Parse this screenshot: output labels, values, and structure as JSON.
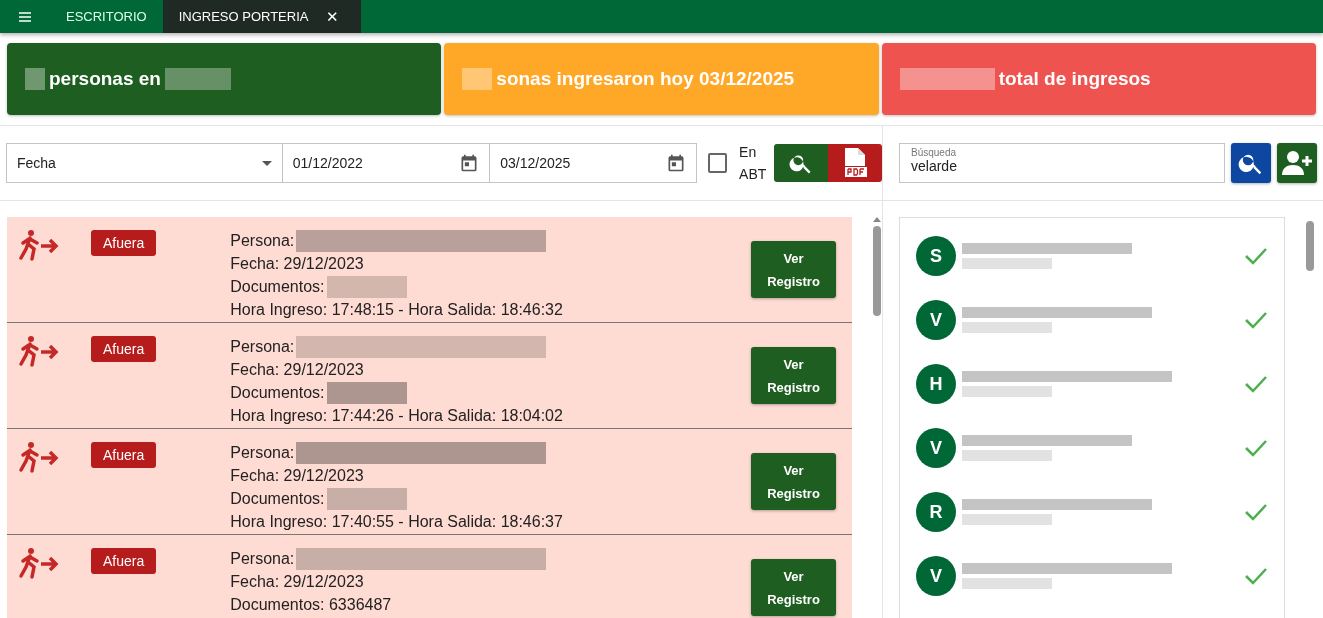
{
  "tabs": [
    {
      "label": "ESCRITORIO",
      "selected": false
    },
    {
      "label": "INGRESO PORTERIA",
      "selected": true,
      "close": "✕"
    }
  ],
  "stats": [
    {
      "text": "personas en",
      "color": "#1e5e20"
    },
    {
      "text": "sonas ingresaron hoy 03/12/2025",
      "color": "#ffa726"
    },
    {
      "text": "total de ingresos",
      "color": "#ef5350"
    }
  ],
  "filters": {
    "type_select": "Fecha",
    "date_from": "01/12/2022",
    "date_to": "03/12/2025",
    "abt": {
      "label_lines": [
        "En",
        "ABT"
      ],
      "checked": false
    },
    "search": {
      "label": "Búsqueda",
      "value": "velarde"
    }
  },
  "records": [
    {
      "status": "Afuera",
      "persona": "Persona:",
      "fecha": "Fecha: 29/12/2023",
      "documentos": "Documentos:",
      "horas": "Hora Ingreso: 17:48:15 - Hora Salida: 18:46:32",
      "button_lines": [
        "Ver",
        "Registro"
      ]
    },
    {
      "status": "Afuera",
      "persona": "Persona:",
      "fecha": "Fecha: 29/12/2023",
      "documentos": "Documentos:",
      "horas": "Hora Ingreso: 17:44:26 - Hora Salida: 18:04:02",
      "button_lines": [
        "Ver",
        "Registro"
      ]
    },
    {
      "status": "Afuera",
      "persona": "Persona:",
      "fecha": "Fecha: 29/12/2023",
      "documentos": "Documentos:",
      "horas": "Hora Ingreso: 17:40:55 - Hora Salida: 18:46:37",
      "button_lines": [
        "Ver",
        "Registro"
      ]
    },
    {
      "status": "Afuera",
      "persona": "Persona:",
      "fecha": "Fecha: 29/12/2023",
      "documentos": "Documentos: 6336487",
      "button_lines": [
        "Ver",
        "Registro"
      ]
    }
  ],
  "people": [
    {
      "initial": "S"
    },
    {
      "initial": "V"
    },
    {
      "initial": "H"
    },
    {
      "initial": "V"
    },
    {
      "initial": "R"
    },
    {
      "initial": "V"
    }
  ]
}
